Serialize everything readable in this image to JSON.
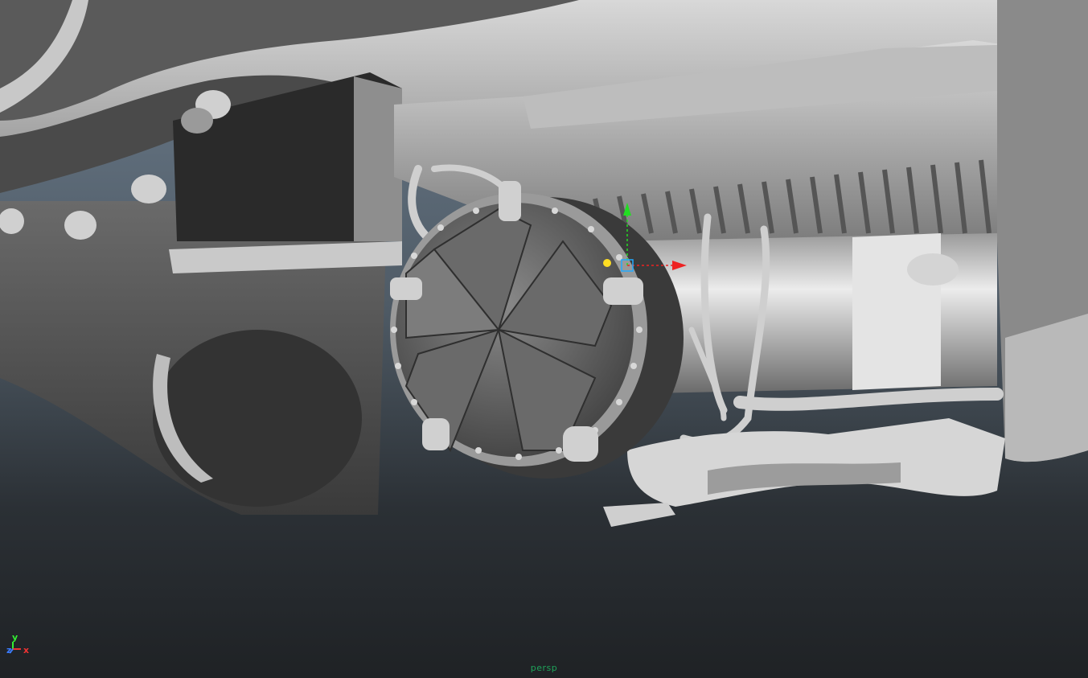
{
  "viewport": {
    "camera_name": "persp",
    "axis_labels": {
      "x": "x",
      "y": "y",
      "z": "z"
    },
    "axis_colors": {
      "x": "#ee3333",
      "y": "#33ee33",
      "z": "#3a7cff"
    },
    "background_colors": {
      "top": "#6c7c8c",
      "bottom": "#1f2225"
    },
    "label_color": "#1fa35a"
  }
}
